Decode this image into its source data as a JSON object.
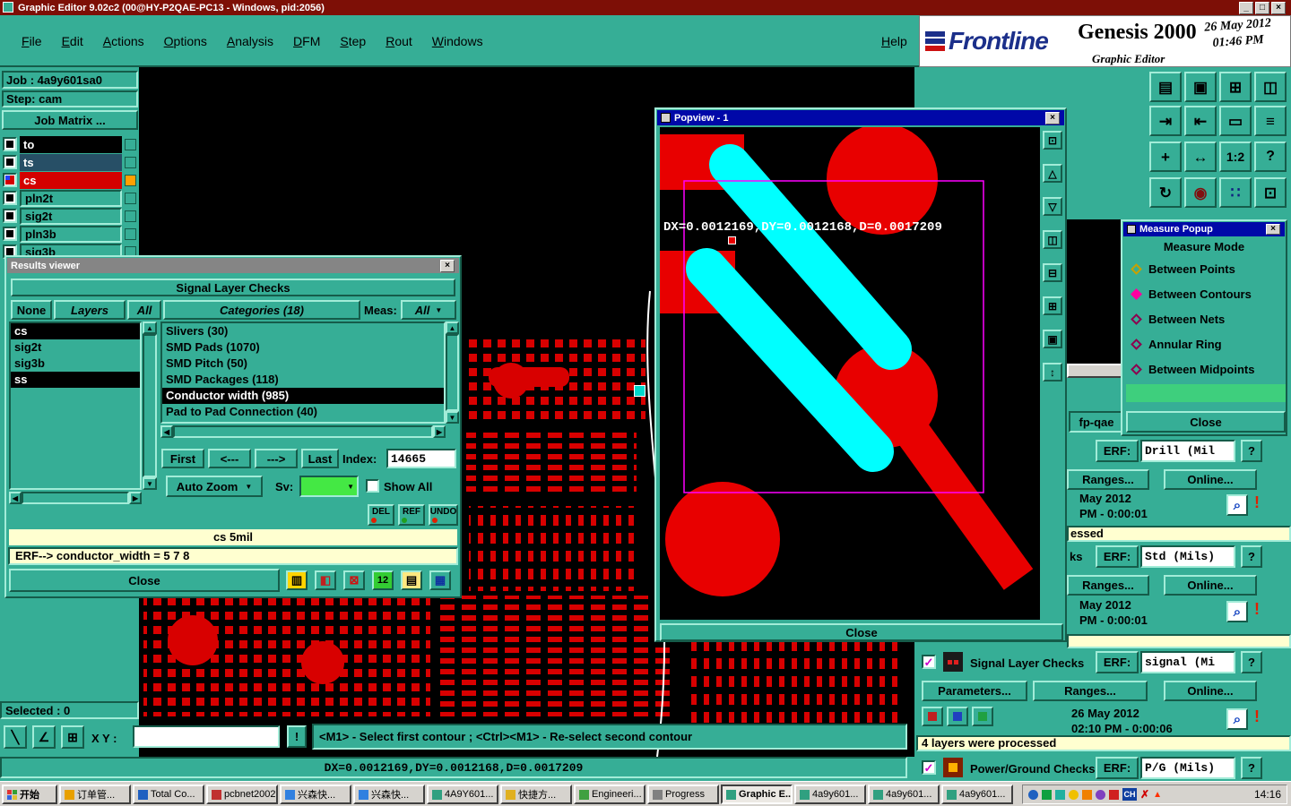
{
  "titlebar": {
    "title": "Graphic Editor 9.02c2 (00@HY-P2QAE-PC13 - Windows, pid:2056)",
    "minimize": "_",
    "maximize": "□",
    "close": "×"
  },
  "menubar": {
    "items": [
      "File",
      "Edit",
      "Actions",
      "Options",
      "Analysis",
      "DFM",
      "Step",
      "Rout",
      "Windows"
    ],
    "help": "Help"
  },
  "brand": {
    "name": "Frontline",
    "product": "Genesis 2000",
    "date": "26 May 2012",
    "time": "01:46 PM",
    "app": "Graphic Editor"
  },
  "colors": {
    "accent_teal": "#36ae96",
    "copper_red": "#e00000",
    "trace_cyan": "#00ffff",
    "measure_magenta": "#ff00ff",
    "info_yellow": "#ffffd0",
    "active_layer_red": "#d40000",
    "selection_black": "#000000"
  },
  "job": {
    "job_label": "Job : 4a9y601sa0",
    "step_label": "Step: cam",
    "matrix_button": "Job Matrix ...",
    "layers": [
      {
        "name": "to"
      },
      {
        "name": "ts"
      },
      {
        "name": "cs"
      },
      {
        "name": "pln2t"
      },
      {
        "name": "sig2t"
      },
      {
        "name": "pln3b"
      },
      {
        "name": "sig3b"
      }
    ]
  },
  "toolbar": {
    "icons": [
      {
        "name": "export-sheet",
        "glyph": "▤"
      },
      {
        "name": "display",
        "glyph": "▣"
      },
      {
        "name": "grid",
        "glyph": "⊞"
      },
      {
        "name": "split-view",
        "glyph": "◫"
      },
      {
        "name": "move-in",
        "glyph": "⇥"
      },
      {
        "name": "move-out",
        "glyph": "⇤"
      },
      {
        "name": "rectangle",
        "glyph": "▭"
      },
      {
        "name": "layers",
        "glyph": "≡"
      },
      {
        "name": "crosshair",
        "glyph": "+"
      },
      {
        "name": "pan",
        "glyph": "↔"
      },
      {
        "name": "ratio",
        "glyph": "1:2"
      },
      {
        "name": "help",
        "glyph": "?"
      },
      {
        "name": "rotate",
        "glyph": "↻"
      },
      {
        "name": "origin",
        "glyph": "◉"
      },
      {
        "name": "netlist",
        "glyph": "∷"
      },
      {
        "name": "matrix",
        "glyph": "⊡"
      }
    ]
  },
  "results": {
    "title": "Results viewer",
    "header": "Signal Layer Checks",
    "none": "None",
    "layers_btn": "Layers",
    "all_btn": "All",
    "categories_header": "Categories (18)",
    "meas_label": "Meas:",
    "meas_value": "All",
    "layer_items": [
      {
        "name": "cs",
        "selected": true
      },
      {
        "name": "sig2t",
        "selected": false
      },
      {
        "name": "sig3b",
        "selected": false
      },
      {
        "name": "ss",
        "selected": true
      }
    ],
    "categories": [
      {
        "label": "Slivers (30)",
        "selected": false
      },
      {
        "label": "SMD Pads (1070)",
        "selected": false
      },
      {
        "label": "SMD Pitch (50)",
        "selected": false
      },
      {
        "label": "SMD Packages (118)",
        "selected": false
      },
      {
        "label": "Conductor width (985)",
        "selected": true
      },
      {
        "label": "Pad to Pad Connection (40)",
        "selected": false
      }
    ],
    "first": "First",
    "prev": "<---",
    "next": "--->",
    "last": "Last",
    "index_label": "Index:",
    "index_value": "14665",
    "auto_zoom": "Auto Zoom",
    "sv_label": "Sv:",
    "show_all": "Show All",
    "del": "DEL",
    "ref": "REF",
    "undo": "UNDO",
    "info_line": "cs 5mil",
    "erf_line": "ERF--> conductor_width = 5 7 8",
    "close": "Close"
  },
  "popview": {
    "title": "Popview - 1",
    "measurement": "DX=0.0012169,DY=0.0012168,D=0.0017209",
    "close": "Close",
    "side_icons": [
      {
        "name": "zoom-window",
        "glyph": "⊡"
      },
      {
        "name": "pan-up",
        "glyph": "△"
      },
      {
        "name": "pan-down",
        "glyph": "▽"
      },
      {
        "name": "compare",
        "glyph": "◫"
      },
      {
        "name": "zoom-out",
        "glyph": "⊟"
      },
      {
        "name": "zoom-in",
        "glyph": "⊞"
      },
      {
        "name": "full-view",
        "glyph": "▣"
      },
      {
        "name": "scroll",
        "glyph": "↕"
      }
    ]
  },
  "measure": {
    "title": "Measure Popup",
    "header": "Measure Mode",
    "options": [
      {
        "label": "Between Points",
        "selected": false
      },
      {
        "label": "Between Contours",
        "selected": true
      },
      {
        "label": "Between Nets",
        "selected": false
      },
      {
        "label": "Annular Ring",
        "selected": false
      },
      {
        "label": "Between Midpoints",
        "selected": false
      }
    ],
    "close": "Close"
  },
  "checks": {
    "fp_label": "fp-qae",
    "panel1": {
      "erf": "ERF:",
      "field": "Drill (Mil",
      "help": "?",
      "ranges": "Ranges...",
      "online": "Online...",
      "date_line1": "May 2012",
      "date_line2": "PM - 0:00:01",
      "zoom_icon": "⌕",
      "alert": "!",
      "result": "essed"
    },
    "panel2": {
      "fragment": "ks",
      "erf": "ERF:",
      "field": "Std (Mils)",
      "help": "?",
      "ranges": "Ranges...",
      "online": "Online...",
      "date_line1": "May 2012",
      "date_line2": "PM - 0:00:01",
      "zoom_icon": "⌕",
      "alert": "!",
      "result": ""
    },
    "panel3": {
      "title": "Signal Layer Checks",
      "erf": "ERF:",
      "field": "signal (Mi",
      "help": "?",
      "parameters": "Parameters...",
      "ranges": "Ranges...",
      "online": "Online...",
      "date_line1": "26 May 2012",
      "date_line2": "02:10 PM - 0:00:06",
      "zoom_icon": "⌕",
      "alert": "!",
      "result": "4 layers were processed"
    },
    "panel4": {
      "title": "Power/Ground Checks",
      "erf": "ERF:",
      "field": "P/G (Mils)",
      "help": "?"
    }
  },
  "statusbar": {
    "selected": "Selected : 0",
    "tools": [
      {
        "name": "select-tool",
        "glyph": "╲"
      },
      {
        "name": "axes-tool",
        "glyph": "∠"
      },
      {
        "name": "grid-tool",
        "glyph": "⊞"
      }
    ],
    "xy_label": "X Y :",
    "xy_value": "",
    "alert": "!",
    "hint": "<M1> - Select first contour ; <Ctrl><M1> - Re-select second contour",
    "measurement": "DX=0.0012169,DY=0.0012168,D=0.0017209"
  },
  "taskbar": {
    "start": "开始",
    "tasks": [
      {
        "label": "订单管..."
      },
      {
        "label": "Total Co..."
      },
      {
        "label": "pcbnet2002"
      },
      {
        "label": "兴森快..."
      },
      {
        "label": "兴森快..."
      },
      {
        "label": "4A9Y601..."
      },
      {
        "label": "快捷方..."
      },
      {
        "label": "Engineeri..."
      },
      {
        "label": "Progress"
      },
      {
        "label": "Graphic E...",
        "active": true
      },
      {
        "label": "4a9y601..."
      },
      {
        "label": "4a9y601..."
      },
      {
        "label": "4a9y601..."
      }
    ],
    "language_badge": "CH",
    "clock": "14:16"
  }
}
